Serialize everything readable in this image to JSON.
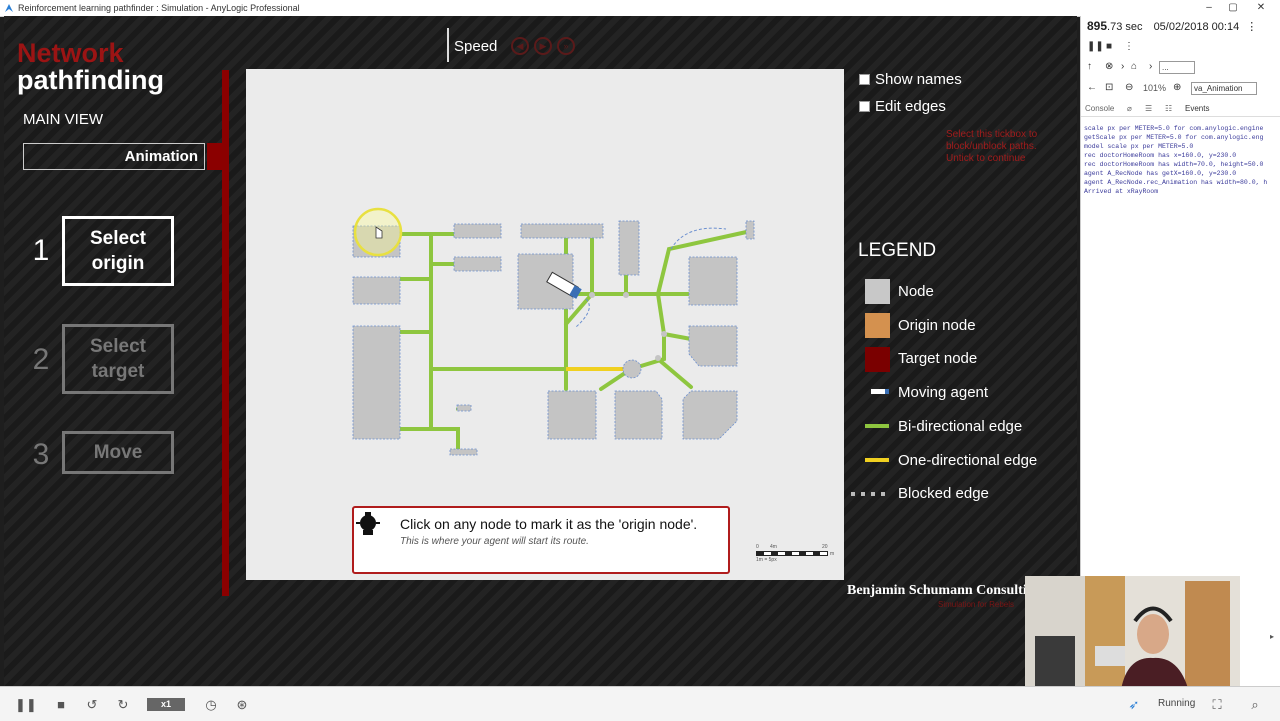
{
  "window": {
    "title": "Reinforcement learning pathfinder : Simulation - AnyLogic Professional",
    "controls": {
      "minimize": "–",
      "maximize": "▢",
      "close": "✕"
    }
  },
  "brand": {
    "line1": "Network",
    "line2": "pathfinding",
    "colors": {
      "red": "#9b1414"
    }
  },
  "nav": {
    "main_view": "MAIN VIEW",
    "animation": "Animation"
  },
  "steps": [
    {
      "num": "1",
      "label": "Select origin",
      "active": true
    },
    {
      "num": "2",
      "label": "Select target",
      "active": false
    },
    {
      "num": "3",
      "label": "Move",
      "active": false
    }
  ],
  "speed": {
    "label": "Speed"
  },
  "options": {
    "show_names": "Show names",
    "edit_edges": "Edit edges",
    "note": "Select this tickbox to block/unblock paths. Untick to continue"
  },
  "legend": {
    "title": "LEGEND",
    "items": [
      {
        "label": "Node",
        "color": "#c8c8c8"
      },
      {
        "label": "Origin node",
        "color": "#d4914f"
      },
      {
        "label": "Target node",
        "color": "#7a0000"
      },
      {
        "label": "Moving agent",
        "color": "#ffffff"
      },
      {
        "label": "Bi-directional edge",
        "color": "#8ec63f"
      },
      {
        "label": "One-directional edge",
        "color": "#f0d020"
      },
      {
        "label": "Blocked edge",
        "color": "#bbbbbb"
      }
    ]
  },
  "hint": {
    "main": "Click on any node to mark it as the 'origin node'.",
    "sub": "This is where your agent will start its route."
  },
  "scale": {
    "left": "0",
    "mid": "4m",
    "right": "20",
    "unit": "m",
    "sub": "1m = 5px"
  },
  "credit": {
    "name": "Benjamin Schumann Consulting",
    "sub": "Simulation for Rebels"
  },
  "runtime": {
    "time_value": "895",
    "time_unit": ".73 sec",
    "date": "05/02/2018 00:14",
    "zoom": "101%",
    "view_select": "va_Animation",
    "nav_select": "...",
    "tabs": [
      "Console",
      "Events"
    ],
    "log": [
      "scale px per METER=5.0 for com.anylogic.engine",
      "getScale px per METER=5.0 for com.anylogic.eng",
      "model scale px per METER=5.0",
      "rec doctorHomeRoom has x=160.0, y=230.0",
      "rec doctorHomeRoom has width=70.0, height=50.0",
      "agent A_RecNode has getX=160.0, y=230.0",
      "agent A_RecNode.rec_Animation has width=80.0, h",
      "Arrived at xRayRoom"
    ]
  },
  "bottom": {
    "speed": "x1",
    "status": "Running"
  }
}
